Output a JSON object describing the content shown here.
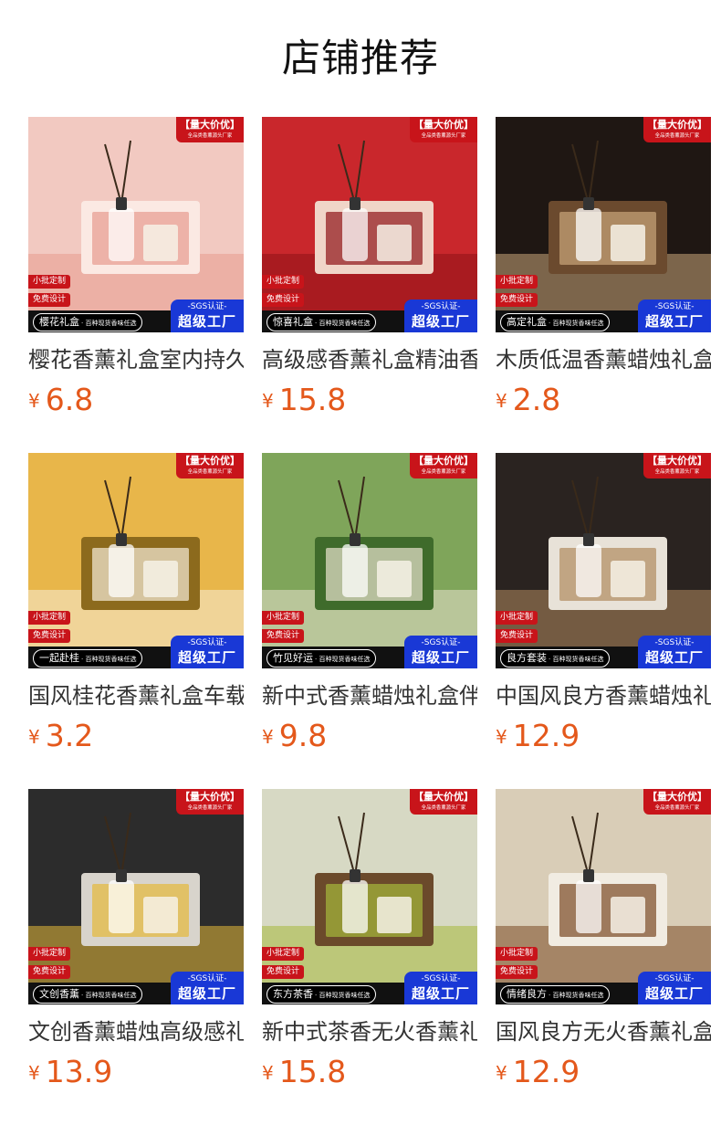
{
  "page": {
    "title": "店铺推荐"
  },
  "common": {
    "badge_top_line1": "【量大价优】",
    "badge_top_line2": "全品类香薰源头厂家",
    "tag_small_batch": "小批定制",
    "tag_free_design": "免费设计",
    "banner_sub": "· 百种现货香味任选",
    "sgs_line1": "-SGS认证-",
    "sgs_line2": "超级工厂",
    "currency": "¥"
  },
  "products": [
    {
      "banner": "樱花礼盒",
      "name": "樱花香薰礼盒室内持久",
      "price": "6.8",
      "colors": [
        "#f2c9c1",
        "#e79a8e",
        "#fbe9e3"
      ]
    },
    {
      "banner": "惊喜礼盒",
      "name": "高级感香薰礼盒精油香",
      "price": "15.8",
      "colors": [
        "#c9272c",
        "#8e1217",
        "#f0d5c8"
      ]
    },
    {
      "banner": "高定礼盒",
      "name": "木质低温香薰蜡烛礼盒",
      "price": "2.8",
      "colors": [
        "#1f1713",
        "#c9a57a",
        "#6b4a2e"
      ]
    },
    {
      "banner": "一起赴桂",
      "name": "国风桂花香薰礼盒车载",
      "price": "3.2",
      "colors": [
        "#e8b64a",
        "#f5ecd8",
        "#8c6a1d"
      ]
    },
    {
      "banner": "竹见好运",
      "name": "新中式香薰蜡烛礼盒伴",
      "price": "9.8",
      "colors": [
        "#7fa55a",
        "#e9e2cf",
        "#3f6b2b"
      ]
    },
    {
      "banner": "良方套装",
      "name": "中国风良方香薰蜡烛礼",
      "price": "12.9",
      "colors": [
        "#2a2320",
        "#b08b5f",
        "#e8e2d8"
      ]
    },
    {
      "banner": "文创香薰",
      "name": "文创香薰蜡烛高级感礼",
      "price": "13.9",
      "colors": [
        "#2c2c2c",
        "#e6b93b",
        "#d8d4cc"
      ]
    },
    {
      "banner": "东方茶香",
      "name": "新中式茶香无火香薰礼",
      "price": "15.8",
      "colors": [
        "#d7d9c4",
        "#a5b83c",
        "#6b4a2b"
      ]
    },
    {
      "banner": "情绪良方",
      "name": "国风良方无火香薰礼盒",
      "price": "12.9",
      "colors": [
        "#d9cdb7",
        "#7a4a25",
        "#f1ece2"
      ]
    }
  ]
}
